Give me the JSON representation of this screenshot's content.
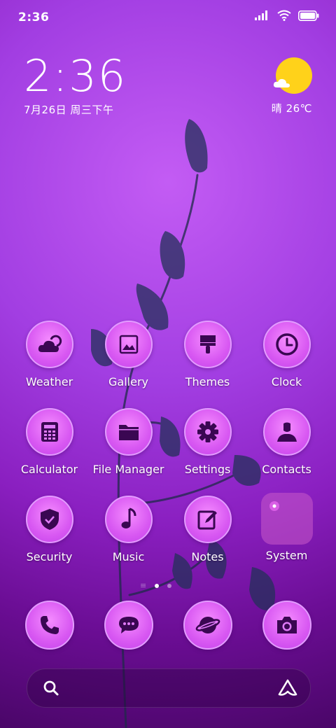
{
  "status_bar": {
    "time": "2:36"
  },
  "clock_widget": {
    "time": "2:36",
    "date": "7月26日 周三下午"
  },
  "weather_widget": {
    "text": "晴 26℃"
  },
  "apps": [
    [
      {
        "label": "Weather",
        "icon": "weather-icon"
      },
      {
        "label": "Gallery",
        "icon": "gallery-icon"
      },
      {
        "label": "Themes",
        "icon": "brush-icon"
      },
      {
        "label": "Clock",
        "icon": "clock-icon"
      }
    ],
    [
      {
        "label": "Calculator",
        "icon": "calculator-icon"
      },
      {
        "label": "File Manager",
        "icon": "folder-icon"
      },
      {
        "label": "Settings",
        "icon": "gear-icon"
      },
      {
        "label": "Contacts",
        "icon": "person-icon"
      }
    ],
    [
      {
        "label": "Security",
        "icon": "shield-icon"
      },
      {
        "label": "Music",
        "icon": "music-note-icon"
      },
      {
        "label": "Notes",
        "icon": "notes-icon"
      },
      {
        "label": "System",
        "icon": "folder-icon"
      }
    ]
  ],
  "dock": [
    {
      "icon": "phone-icon"
    },
    {
      "icon": "message-icon"
    },
    {
      "icon": "browser-planet-icon"
    },
    {
      "icon": "camera-icon"
    }
  ],
  "colors": {
    "accent": "#d858f2",
    "sun": "#ffd21a",
    "icon_glyph": "#3a0752"
  }
}
